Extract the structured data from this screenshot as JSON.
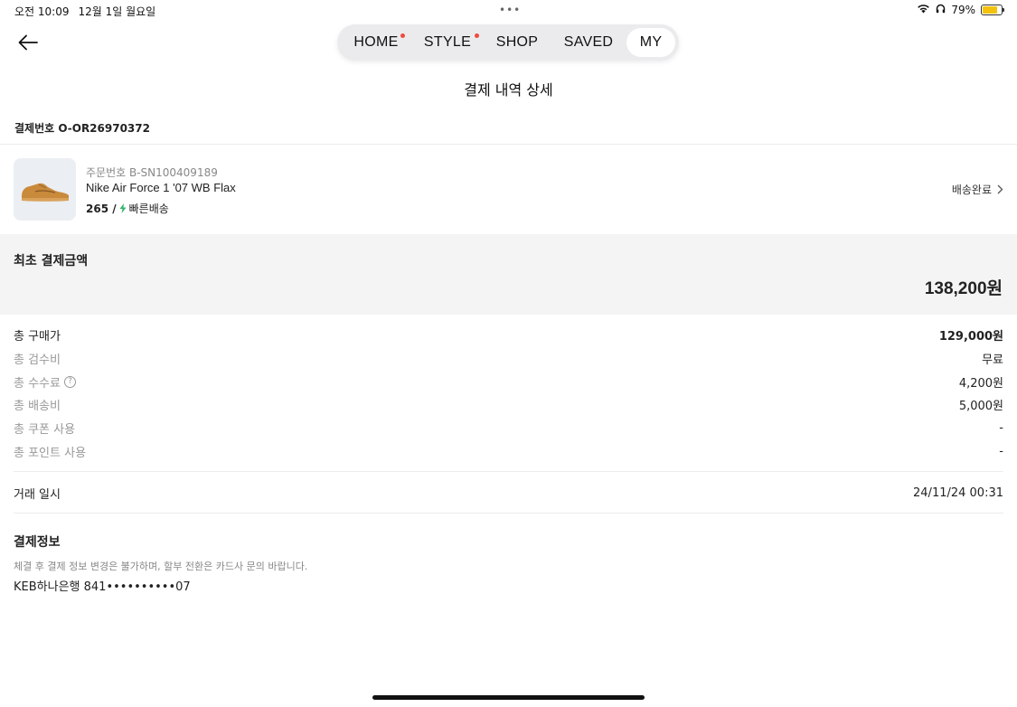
{
  "status_bar": {
    "time": "오전 10:09",
    "date": "12월 1일 월요일",
    "battery": "79%",
    "battery_level": 0.79,
    "battery_color": "#f4c20d"
  },
  "nav": {
    "tabs": [
      {
        "label": "HOME",
        "dot": true
      },
      {
        "label": "STYLE",
        "dot": true
      },
      {
        "label": "SHOP",
        "dot": false
      },
      {
        "label": "SAVED",
        "dot": false
      },
      {
        "label": "MY",
        "dot": false,
        "active": true
      }
    ],
    "dot_color": "#ef4b3f"
  },
  "page_title": "결제 내역 상세",
  "payment_number": "결제번호 O-OR26970372",
  "product": {
    "order_number": "주문번호 B-SN100409189",
    "name": "Nike Air Force 1 '07 WB Flax",
    "size": "265 /",
    "shipping": "빠른배송",
    "shipping_icon_color": "#31b46e",
    "status": "배송완료"
  },
  "summary": {
    "label": "최초 결제금액",
    "amount": "138,200원"
  },
  "breakdown": [
    {
      "label": "총 구매가",
      "value": "129,000원"
    },
    {
      "label": "총 검수비",
      "value": "무료"
    },
    {
      "label": "총 수수료",
      "value": "4,200원",
      "help": "?"
    },
    {
      "label": "총 배송비",
      "value": "5,000원"
    },
    {
      "label": "총 쿠폰 사용",
      "value": "-"
    },
    {
      "label": "총 포인트 사용",
      "value": "-"
    }
  ],
  "transaction": {
    "label": "거래 일시",
    "value": "24/11/24 00:31"
  },
  "payment_info": {
    "title": "결제정보",
    "note": "체결 후 결제 정보 변경은 불가하며, 할부 전환은 카드사 문의 바랍니다.",
    "account": "KEB하나은행 841••••••••••07"
  }
}
